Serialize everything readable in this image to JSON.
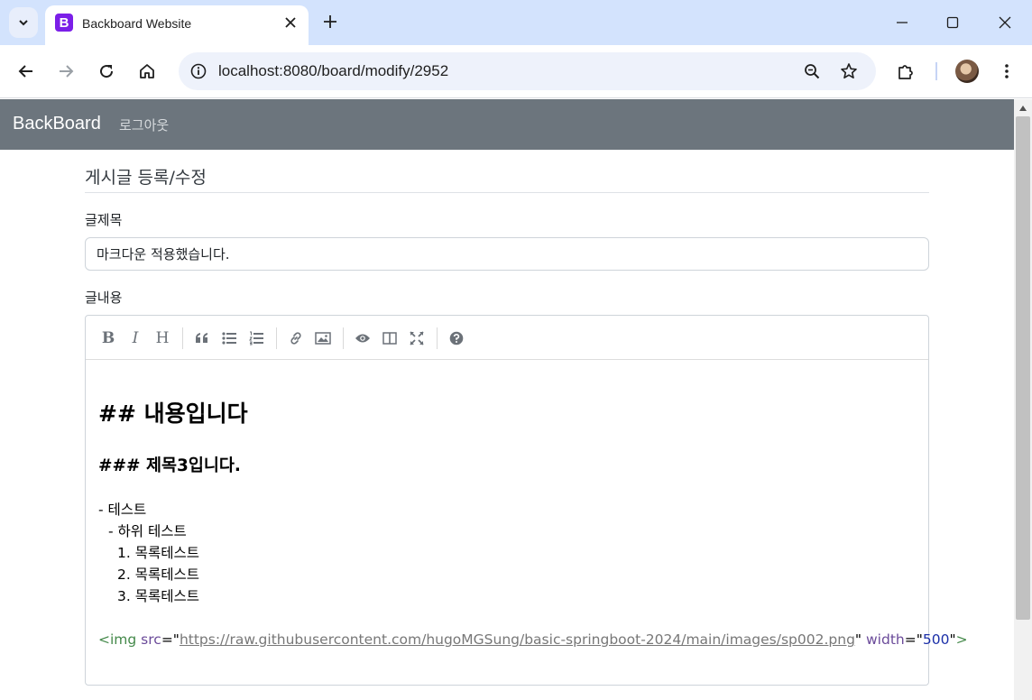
{
  "browser": {
    "tab_title": "Backboard Website",
    "favicon_letter": "B",
    "url": "localhost:8080/board/modify/2952"
  },
  "navbar": {
    "brand": "BackBoard",
    "logout_label": "로그아웃"
  },
  "page": {
    "heading": "게시글 등록/수정",
    "title_label": "글제목",
    "title_value": "마크다운 적용했습니다.",
    "content_label": "글내용"
  },
  "editor": {
    "toolbar": {
      "bold": "B",
      "italic": "I",
      "heading": "H"
    },
    "content": {
      "h2": "## 내용입니다",
      "h3": "### 제목3입니다.",
      "list_1": "- 테스트",
      "list_2": "- 하위 테스트",
      "list_3": "1. 목록테스트",
      "list_4": "2. 목록테스트",
      "list_5": "3. 목록테스트",
      "img_tag_open": "<img",
      "img_attr_src": "src",
      "img_eq_quote": "=\"",
      "img_url": "https://raw.githubusercontent.com/hugoMGSung/basic-springboot-2024/main/images/sp002.png",
      "img_quote": "\"",
      "img_attr_width": "width",
      "img_width_value": "500",
      "img_tag_close": ">"
    }
  }
}
